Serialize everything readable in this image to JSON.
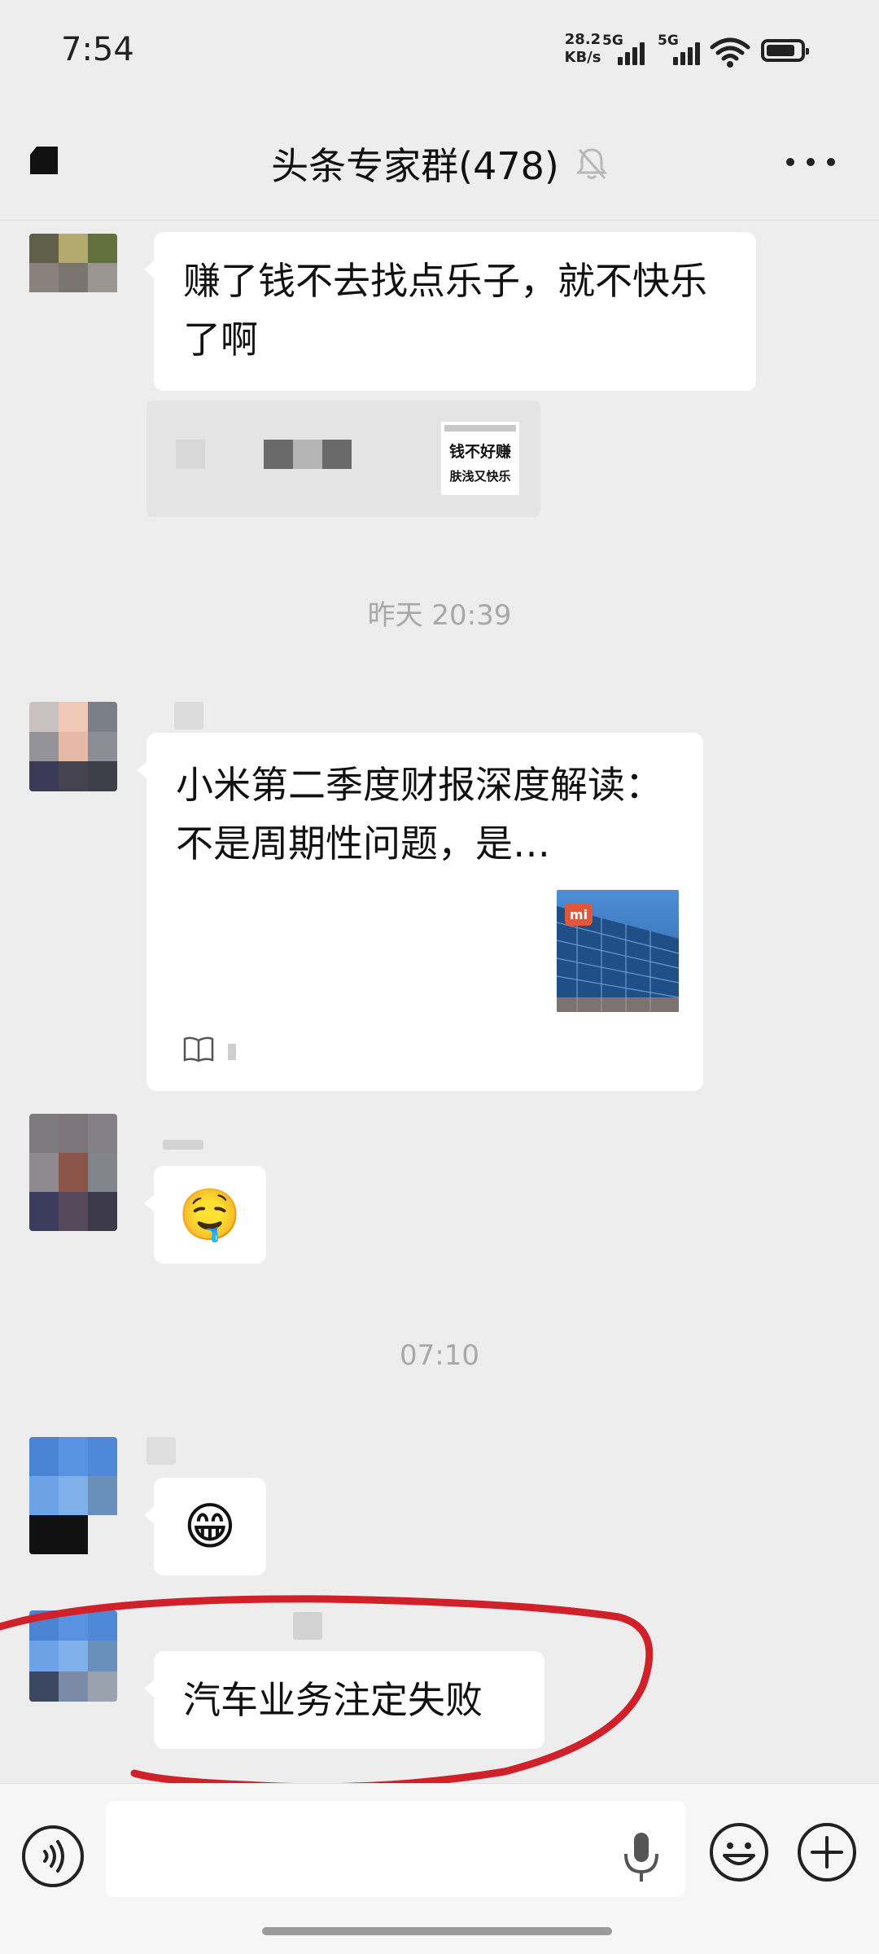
{
  "status_bar": {
    "time": "7:54",
    "net_speed_value": "28.2",
    "net_speed_unit": "KB/s",
    "signal1_label": "5G",
    "signal2_label": "5G",
    "battery_icon": "battery-icon",
    "wifi_icon": "wifi-icon"
  },
  "header": {
    "title": "头条专家群(478)",
    "mute_icon": "bell-muted-icon",
    "more_icon": "more-icon",
    "back_icon": "back-icon"
  },
  "messages": {
    "m1_text": "赚了钱不去找点乐子，就不快乐了啊",
    "m1_sticker_line1": "钱不好赚",
    "m1_sticker_line2": "肤浅又快乐",
    "time1": "昨天 20:39",
    "m2_article_title": "小米第二季度财报深度解读：不是周期性问题，是…",
    "m2_article_icon": "book-icon",
    "m3_emoji": "🤤",
    "time2": "07:10",
    "m4_emoji": "😁",
    "m5_text": "汽车业务注定失败"
  },
  "input": {
    "voice_icon": "voice-icon",
    "placeholder": "",
    "mic_icon": "mic-icon",
    "emoji_icon": "emoji-icon",
    "plus_icon": "plus-icon"
  },
  "colors": {
    "background": "#ededed",
    "bubble": "#ffffff",
    "annotation": "#d0202a",
    "timestamp": "#a8a8a8"
  }
}
